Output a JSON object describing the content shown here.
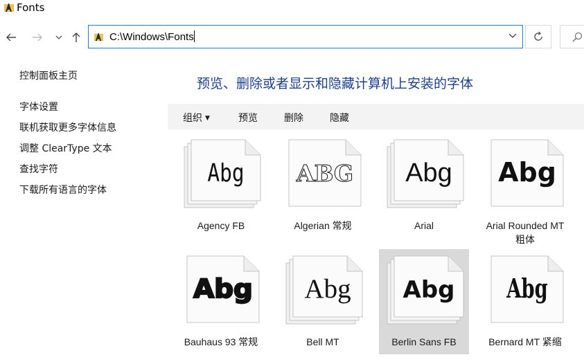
{
  "window": {
    "title": "Fonts"
  },
  "address": {
    "path": "C:\\Windows\\Fonts"
  },
  "sidebar": {
    "home": "控制面板主页",
    "links": [
      "字体设置",
      "联机获取更多字体信息",
      "调整 ClearType 文本",
      "查找字符",
      "下载所有语言的字体"
    ]
  },
  "main": {
    "heading": "预览、删除或者显示和隐藏计算机上安装的字体",
    "commands": {
      "organize": "组织",
      "preview": "预览",
      "delete": "删除",
      "hide": "隐藏"
    }
  },
  "fonts": [
    {
      "name": "Agency FB",
      "sample": "Abg",
      "family_style": "family",
      "selected": false
    },
    {
      "name": "Algerian 常规",
      "sample": "ABG",
      "family_style": "single",
      "selected": false
    },
    {
      "name": "Arial",
      "sample": "Abg",
      "family_style": "family",
      "selected": false
    },
    {
      "name": "Arial Rounded MT 粗体",
      "sample": "Abg",
      "family_style": "single",
      "selected": false
    },
    {
      "name": "Bauhaus 93 常规",
      "sample": "Abg",
      "family_style": "single",
      "selected": false
    },
    {
      "name": "Bell MT",
      "sample": "Abg",
      "family_style": "family",
      "selected": false
    },
    {
      "name": "Berlin Sans FB",
      "sample": "Abg",
      "family_style": "family",
      "selected": true
    },
    {
      "name": "Bernard MT 紧缩",
      "sample": "Abg",
      "family_style": "single",
      "selected": false
    }
  ]
}
